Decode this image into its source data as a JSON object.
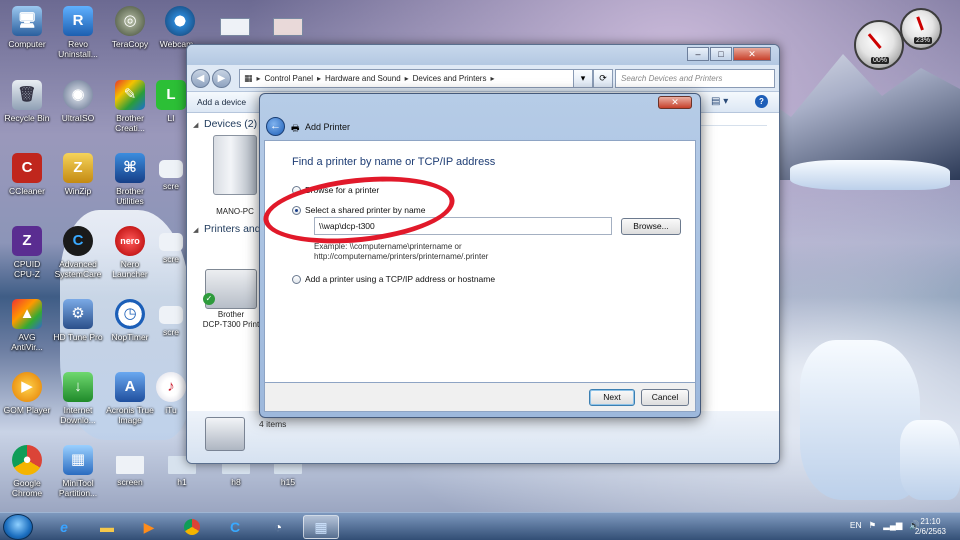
{
  "desktop_icons": [
    {
      "label": "Computer"
    },
    {
      "label": "Revo\nUninstall..."
    },
    {
      "label": "TeraCopy"
    },
    {
      "label": "Webcam..."
    },
    {
      "label": "Recycle Bin"
    },
    {
      "label": "UltraISO"
    },
    {
      "label": "Brother\nCreati..."
    },
    {
      "label": "CCleaner"
    },
    {
      "label": "WinZip"
    },
    {
      "label": "Brother\nUtilities"
    },
    {
      "label": "CPUID\nCPU-Z"
    },
    {
      "label": "Advanced\nSystemCare"
    },
    {
      "label": "Nero\nLauncher"
    },
    {
      "label": "AVG\nAntiVir..."
    },
    {
      "label": "HD Tune Pro"
    },
    {
      "label": "NopTimer"
    },
    {
      "label": "GOM Player"
    },
    {
      "label": "Internet\nDownlo..."
    },
    {
      "label": "Acronis True\nImage"
    },
    {
      "label": "Google\nChrome"
    },
    {
      "label": "MiniTool\nPartition..."
    },
    {
      "label": "screen"
    },
    {
      "label": "h1"
    },
    {
      "label": "h8"
    },
    {
      "label": "h15"
    },
    {
      "label": "LI"
    },
    {
      "label": "scre"
    },
    {
      "label": "scre"
    },
    {
      "label": "scre"
    },
    {
      "label": "scre"
    },
    {
      "label": "iTu"
    }
  ],
  "explorer": {
    "breadcrumb": [
      "Control Panel",
      "Hardware and Sound",
      "Devices and Printers"
    ],
    "search_placeholder": "Search Devices and Printers",
    "toolbar_add_device": "Add a device",
    "group_devices": "Devices (2)",
    "group_printers": "Printers and",
    "device_mano": "MANO-PC",
    "printer_brother": "Brother\nDCP-T300 Print",
    "items_count": "4 items"
  },
  "dialog": {
    "title": "Add Printer",
    "heading": "Find a printer by name or TCP/IP address",
    "option_browse": "Browse for a printer",
    "option_shared": "Select a shared printer by name",
    "option_tcpip": "Add a printer using a TCP/IP address or hostname",
    "shared_value": "\\\\wap\\dcp-t300",
    "example_line1": "Example: \\\\computername\\printername or",
    "example_line2": "http://computername/printers/printername/.printer",
    "browse_button": "Browse...",
    "next_button": "Next",
    "cancel_button": "Cancel",
    "selected_option": "shared"
  },
  "gadgets": {
    "cpu_percent": "00%",
    "mem_percent": "23%"
  },
  "taskbar": {
    "language": "EN",
    "time": "21:10",
    "date": "2/6/2563"
  },
  "colors": {
    "annotation_circle": "#e1192a",
    "dialog_heading": "#1e3d74"
  }
}
